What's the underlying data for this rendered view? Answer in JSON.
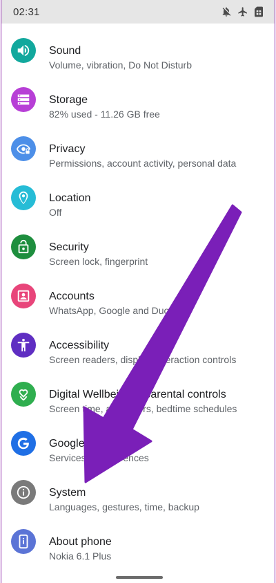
{
  "status_bar": {
    "time": "02:31",
    "icons": [
      "notifications-off-icon",
      "airplane-mode-icon",
      "sim-card-icon"
    ]
  },
  "settings": {
    "items": [
      {
        "title": "Sound",
        "subtitle": "Volume, vibration, Do Not Disturb",
        "icon": "volume-icon",
        "color": "#12a89d"
      },
      {
        "title": "Storage",
        "subtitle": "82% used - 11.26 GB free",
        "icon": "storage-icon",
        "color": "#b73fd6"
      },
      {
        "title": "Privacy",
        "subtitle": "Permissions, account activity, personal data",
        "icon": "eye-lock-icon",
        "color": "#4d8fe8"
      },
      {
        "title": "Location",
        "subtitle": "Off",
        "icon": "location-pin-icon",
        "color": "#26bcd6"
      },
      {
        "title": "Security",
        "subtitle": "Screen lock, fingerprint",
        "icon": "lock-open-icon",
        "color": "#1e8e3e"
      },
      {
        "title": "Accounts",
        "subtitle": "WhatsApp, Google and Duo",
        "icon": "account-box-icon",
        "color": "#e8457a"
      },
      {
        "title": "Accessibility",
        "subtitle": "Screen readers, display, interaction controls",
        "icon": "accessibility-icon",
        "color": "#5f2ec2"
      },
      {
        "title": "Digital Wellbeing & parental controls",
        "subtitle": "Screen time, app timers, bedtime schedules",
        "icon": "wellbeing-heart-icon",
        "color": "#2fae4f"
      },
      {
        "title": "Google",
        "subtitle": "Services & preferences",
        "icon": "google-g-icon",
        "color": "#1f6fe5"
      },
      {
        "title": "System",
        "subtitle": "Languages, gestures, time, backup",
        "icon": "info-icon",
        "color": "#7a7a7a"
      },
      {
        "title": "About phone",
        "subtitle": "Nokia 6.1 Plus",
        "icon": "phone-info-icon",
        "color": "#5b74d6"
      }
    ]
  },
  "annotation": {
    "arrow_color": "#7a1fb8"
  }
}
